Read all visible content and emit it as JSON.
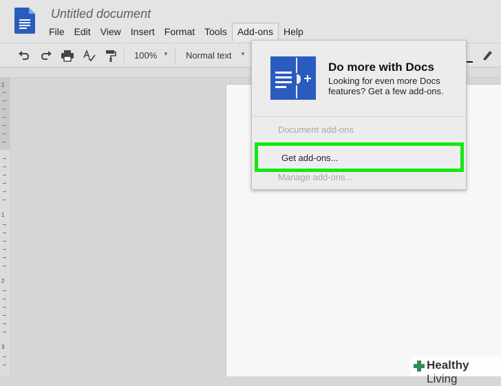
{
  "document": {
    "title": "Untitled document"
  },
  "menu": [
    {
      "label": "File"
    },
    {
      "label": "Edit"
    },
    {
      "label": "View"
    },
    {
      "label": "Insert"
    },
    {
      "label": "Format"
    },
    {
      "label": "Tools"
    },
    {
      "label": "Add-ons",
      "active": true
    },
    {
      "label": "Help"
    }
  ],
  "toolbar": {
    "zoom": "100%",
    "style": "Normal text",
    "icons": [
      "undo-icon",
      "redo-icon",
      "print-icon",
      "spellcheck-icon",
      "paint-format-icon",
      "highlighter-icon"
    ]
  },
  "ruler": {
    "numbers": [
      "1",
      "1",
      "2",
      "3"
    ]
  },
  "addons_menu": {
    "promo_title": "Do more with Docs",
    "promo_body": "Looking for even more Docs features? Get a few add-ons.",
    "items": [
      {
        "label": "Document add-ons",
        "enabled": false
      },
      {
        "label": "Get add-ons...",
        "enabled": true,
        "highlighted": true
      },
      {
        "label": "Manage add-ons...",
        "enabled": false
      }
    ],
    "highlight_color": "#14e814"
  },
  "watermark": {
    "text_a": "Healthy",
    "text_b": " Living"
  },
  "colors": {
    "docs_blue": "#2a5cbf",
    "background": "#d6d6d6",
    "page": "#f7f7f7"
  }
}
